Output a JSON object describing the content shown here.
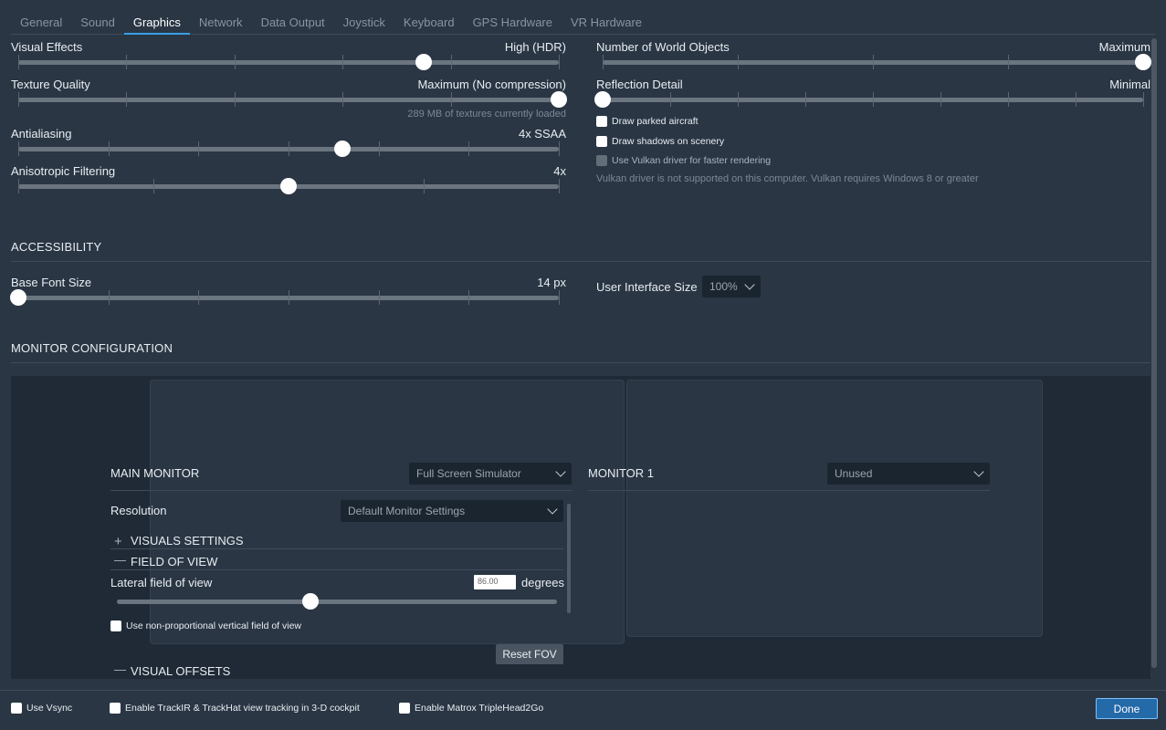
{
  "tabs": [
    "General",
    "Sound",
    "Graphics",
    "Network",
    "Data Output",
    "Joystick",
    "Keyboard",
    "GPS Hardware",
    "VR Hardware"
  ],
  "active_tab": "Graphics",
  "left": {
    "visual_effects": {
      "label": "Visual Effects",
      "value": "High (HDR)",
      "level": 0.75
    },
    "texture_quality": {
      "label": "Texture Quality",
      "value": "Maximum (No compression)",
      "note": "289 MB of textures currently loaded",
      "level": 1.0
    },
    "antialiasing": {
      "label": "Antialiasing",
      "value": "4x SSAA",
      "level": 0.6
    },
    "anisotropic": {
      "label": "Anisotropic Filtering",
      "value": "4x",
      "level": 0.5
    }
  },
  "right": {
    "world_objects": {
      "label": "Number of World Objects",
      "value": "Maximum",
      "level": 1.0
    },
    "reflection": {
      "label": "Reflection Detail",
      "value": "Minimal",
      "level": 0.0
    },
    "draw_parked": "Draw parked aircraft",
    "draw_shadows": "Draw shadows on scenery",
    "vulkan": "Use Vulkan driver for faster rendering",
    "vulkan_note": "Vulkan driver is not supported on this computer. Vulkan requires Windows 8 or greater"
  },
  "accessibility": {
    "title": "ACCESSIBILITY",
    "base_font": {
      "label": "Base Font Size",
      "value": "14 px",
      "level": 0.0
    },
    "ui_size": {
      "label": "User Interface Size",
      "value": "100%"
    }
  },
  "monitor": {
    "title": "MONITOR CONFIGURATION",
    "main_label": "MAIN MONITOR",
    "main_mode": "Full Screen Simulator",
    "monitor1_label": "MONITOR 1",
    "monitor1_mode": "Unused",
    "resolution_label": "Resolution",
    "resolution_value": "Default Monitor Settings",
    "visuals_settings": "VISUALS SETTINGS",
    "field_of_view": "FIELD OF VIEW",
    "lateral_label": "Lateral field of view",
    "lateral_value": "86.00",
    "lateral_unit": "degrees",
    "lateral_level": 0.44,
    "non_prop": "Use non-proportional vertical field of view",
    "reset_fov": "Reset FOV",
    "visual_offsets": "VISUAL OFFSETS"
  },
  "bottom": {
    "vsync": "Use Vsync",
    "trackir": "Enable TrackIR & TrackHat view tracking in 3-D cockpit",
    "matrox": "Enable Matrox TripleHead2Go",
    "done": "Done"
  }
}
